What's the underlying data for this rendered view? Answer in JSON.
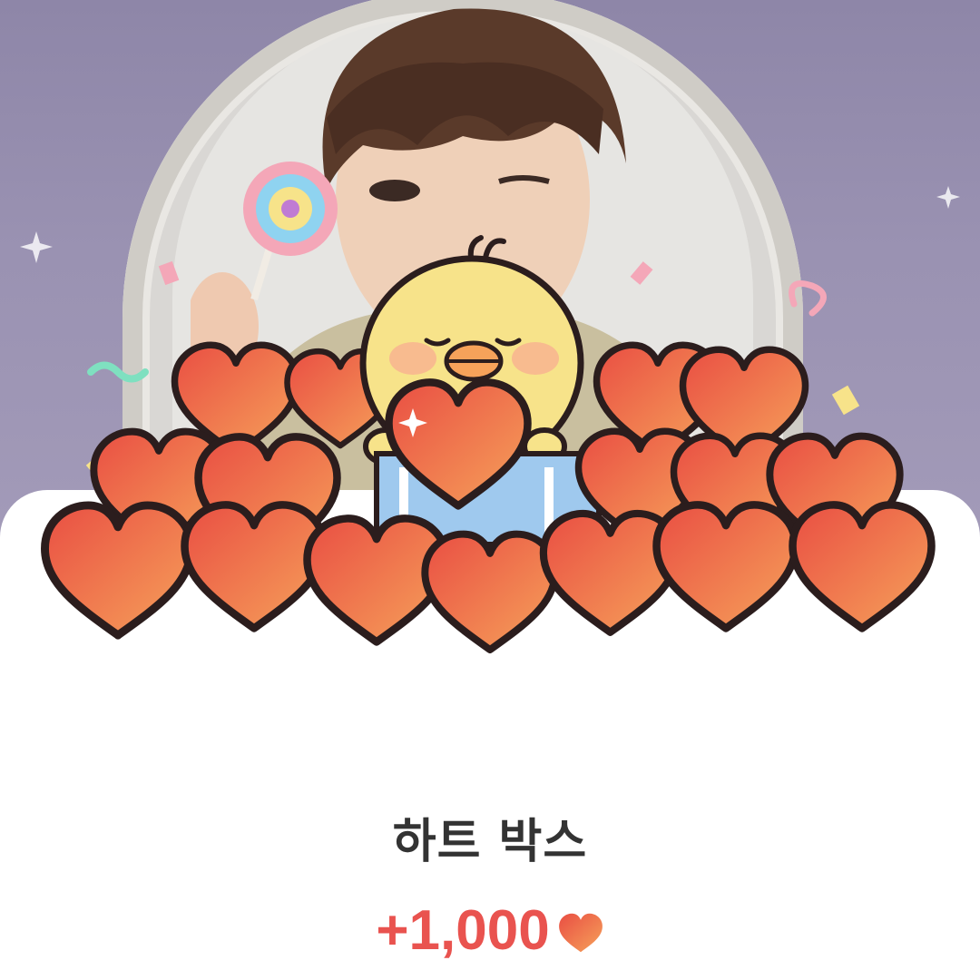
{
  "reward_popup": {
    "title": "하트 박스",
    "amount": "+1,000",
    "currency_icon": "heart-icon",
    "accent_color": "#e9534f"
  },
  "colors": {
    "heart_fill": "#f0714f",
    "backdrop": "#968eae",
    "chick": "#f7e38a"
  }
}
